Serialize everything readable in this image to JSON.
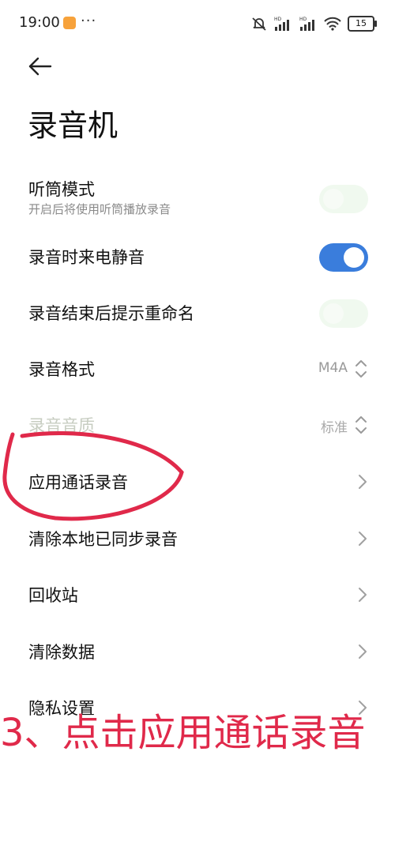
{
  "status_bar": {
    "time": "19:00",
    "battery": "15"
  },
  "header": {
    "title": "录音机"
  },
  "settings": {
    "earpiece": {
      "title": "听筒模式",
      "subtitle": "开启后将使用听筒播放录音"
    },
    "mute_calls": {
      "title": "录音时来电静音"
    },
    "rename_prompt": {
      "title": "录音结束后提示重命名"
    },
    "format": {
      "title": "录音格式",
      "value": "M4A"
    },
    "quality": {
      "title": "录音音质",
      "value": "标准"
    },
    "call_recording": {
      "title": "应用通话录音"
    },
    "clear_synced": {
      "title": "清除本地已同步录音"
    },
    "recycle_bin": {
      "title": "回收站"
    },
    "clear_data": {
      "title": "清除数据"
    },
    "privacy": {
      "title": "隐私设置"
    }
  },
  "toggle_states": {
    "earpiece": "off",
    "mute_calls": "on",
    "rename_prompt": "off"
  },
  "colors": {
    "accent": "#3a7ddc",
    "annotation": "#e0294a",
    "toggle_off": "#f0f9ef",
    "disabled_text": "#c7cdc1"
  },
  "overlay": {
    "instruction": "3、点击应用通话录音"
  }
}
